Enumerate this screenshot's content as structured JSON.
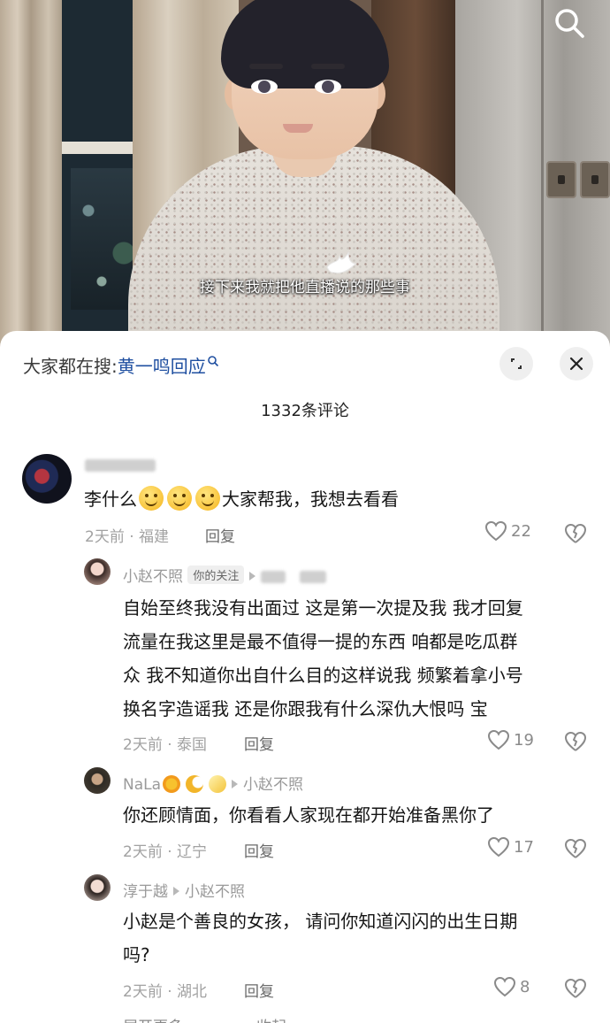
{
  "video": {
    "subtitle": "接下来我就把他直播说的那些事"
  },
  "sheet": {
    "search_prefix": "大家都在搜:",
    "search_keyword": "黄一鸣回应",
    "comment_count": "1332条评论"
  },
  "comments": [
    {
      "text_before": "李什么",
      "text_after": "大家帮我，我想去看看",
      "time_location": "2天前 · 福建",
      "reply_label": "回复",
      "likes": "22"
    }
  ],
  "replies": [
    {
      "username": "小赵不照",
      "tag": "你的关注",
      "lines": [
        "自始至终我没有出面过 这是第一次提及我 我才回复",
        "流量在我这里是最不值得一提的东西 咱都是吃瓜群",
        "众 我不知道你出自什么目的这样说我 频繁着拿小号",
        "换名字造谣我 还是你跟我有什么深仇大恨吗 宝"
      ],
      "time_location": "2天前 · 泰国",
      "reply_label": "回复",
      "likes": "19"
    },
    {
      "username": "NaLa",
      "reply_to": "小赵不照",
      "lines": [
        "你还顾情面，你看看人家现在都开始准备黑你了"
      ],
      "time_location": "2天前 · 辽宁",
      "reply_label": "回复",
      "likes": "17"
    },
    {
      "username": "淳于越",
      "reply_to": "小赵不照",
      "lines": [
        "小赵是个善良的女孩， 请问你知道闪闪的出生日期",
        "吗?"
      ],
      "time_location": "2天前 · 湖北",
      "reply_label": "回复",
      "likes": "8"
    }
  ],
  "footer": {
    "expand_label": "展开更多",
    "collapse_label": "收起"
  },
  "colors": {
    "keyword": "#1f4fa0",
    "meta": "#a2a2a2",
    "icon": "#8a8a8a"
  }
}
